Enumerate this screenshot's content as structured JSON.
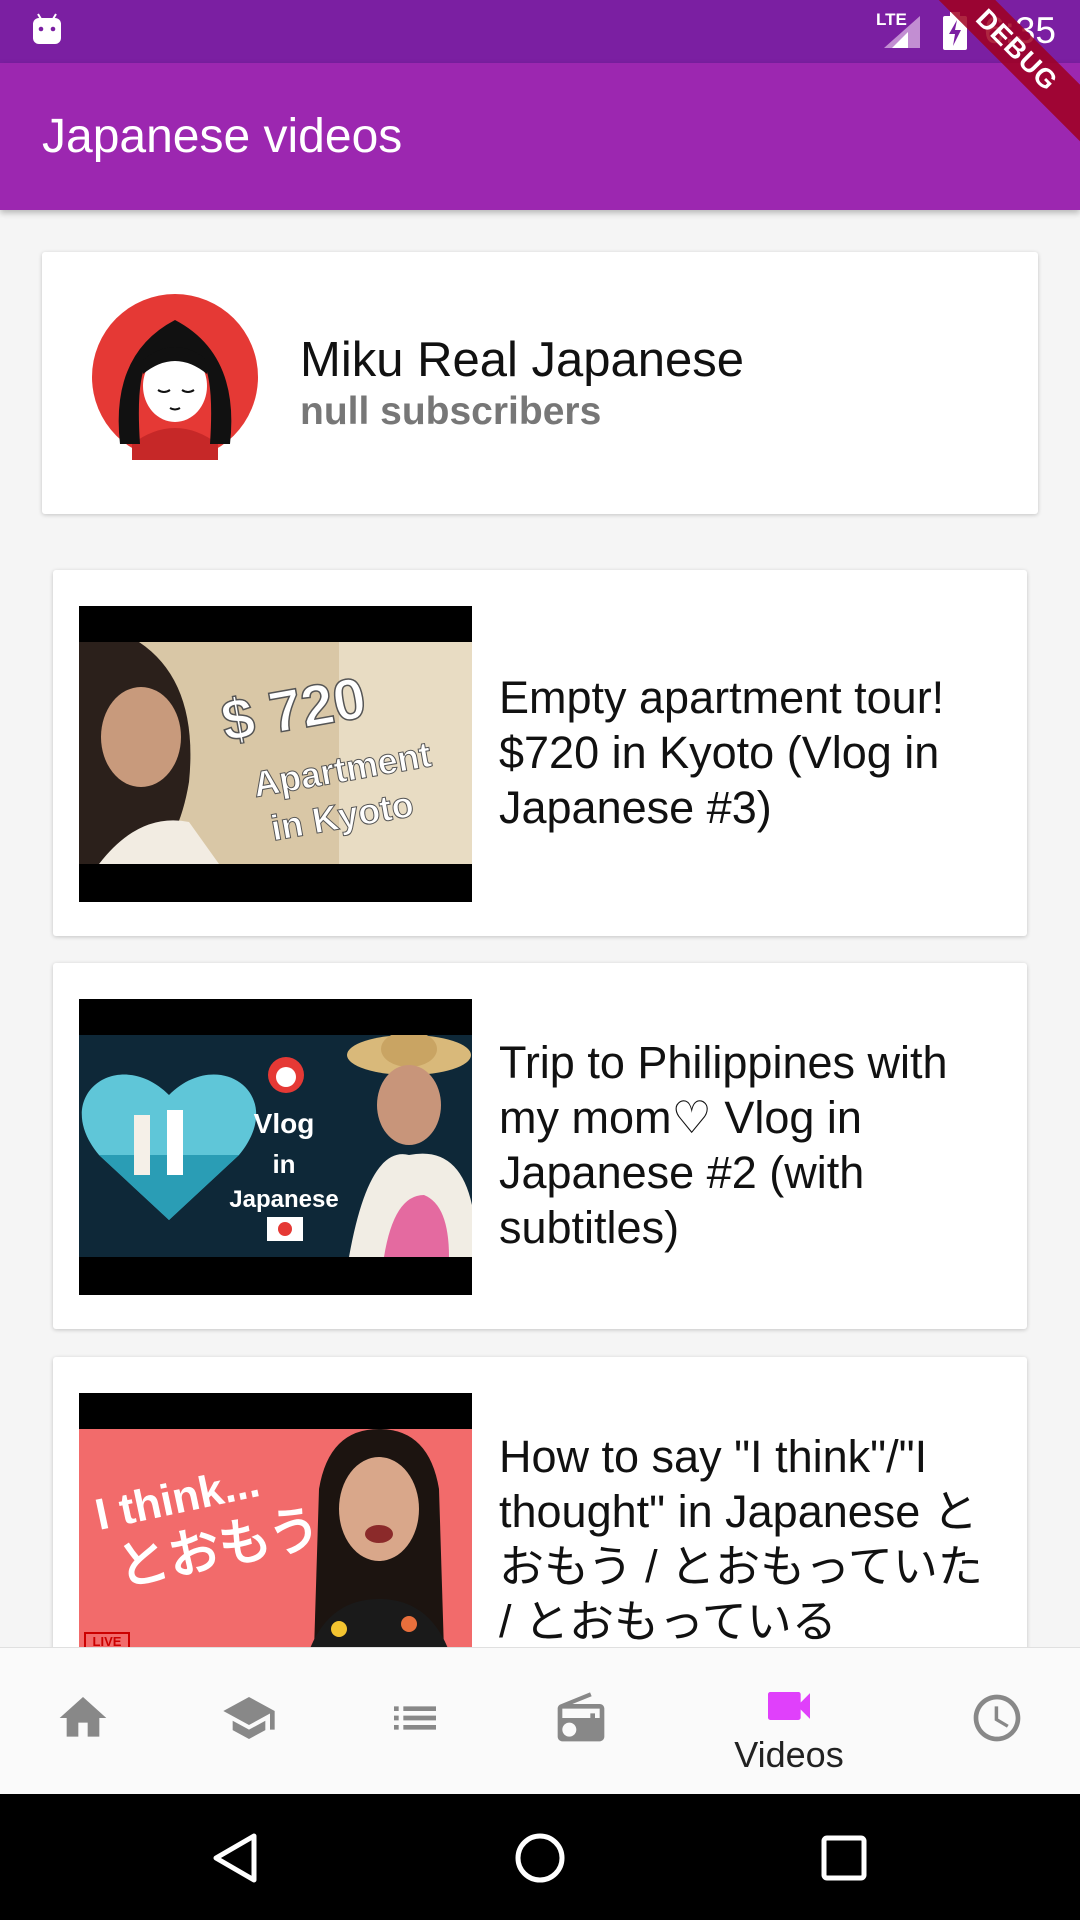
{
  "status_bar": {
    "time": "6:35",
    "network": "LTE",
    "debug_banner": "DEBUG"
  },
  "app_bar": {
    "title": "Japanese videos"
  },
  "channel": {
    "name": "Miku Real Japanese",
    "subscribers": "null subscribers"
  },
  "videos": [
    {
      "title": "Empty apartment tour! $720 in Kyoto (Vlog in Japanese #3)",
      "thumb_text": [
        "$ 720",
        "Apartment",
        "in Kyoto"
      ]
    },
    {
      "title": "Trip to Philippines with my mom♡ Vlog in Japanese #2 (with subtitles)",
      "thumb_text": [
        "Vlog",
        "in",
        "Japanese"
      ]
    },
    {
      "title": "How to say  \"I think\"/\"I thought\" in Japanese とおもう / とおもっていた / とおもっている",
      "thumb_text": [
        "I think...",
        "とおもう",
        "LIVE"
      ]
    }
  ],
  "bottom_nav": {
    "items": [
      {
        "icon": "home-icon",
        "label": ""
      },
      {
        "icon": "school-icon",
        "label": ""
      },
      {
        "icon": "list-icon",
        "label": ""
      },
      {
        "icon": "radio-icon",
        "label": ""
      },
      {
        "icon": "videocam-icon",
        "label": "Videos"
      },
      {
        "icon": "clock-icon",
        "label": ""
      }
    ],
    "active_color": "#e040fb",
    "inactive_color": "#888888"
  }
}
